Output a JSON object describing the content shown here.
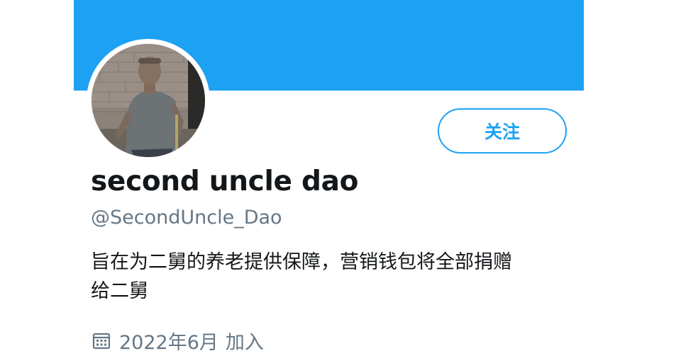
{
  "profile": {
    "follow_label": "关注",
    "display_name": "second uncle dao",
    "handle": "@SecondUncle_Dao",
    "bio_line1": "旨在为二舅的养老提供保障，营销钱包将全部捐赠",
    "bio_line2": "给二舅",
    "joined_date": "2022年6月",
    "joined_suffix": "加入",
    "calendar_icon": "calendar-icon"
  },
  "colors": {
    "accent": "#1da1f2",
    "text_primary": "#14171a",
    "text_secondary": "#657786",
    "background": "#ffffff"
  }
}
